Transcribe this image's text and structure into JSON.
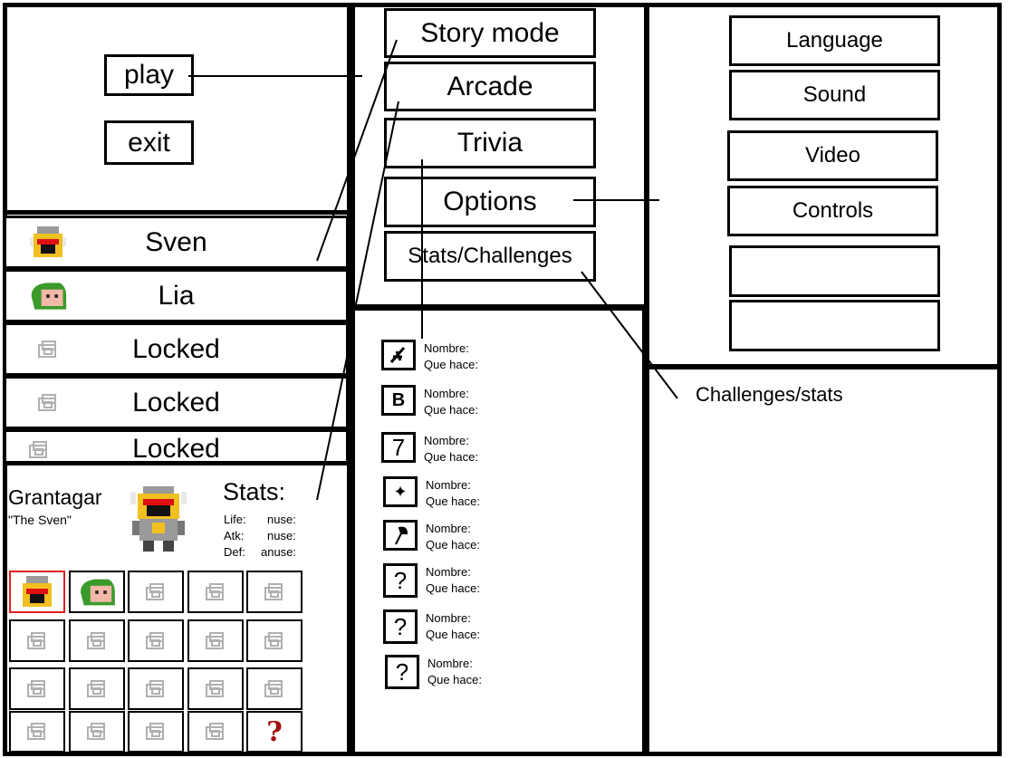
{
  "main_menu": {
    "play_label": "play",
    "exit_label": "exit"
  },
  "mode_menu": {
    "items": [
      {
        "label": "Story mode"
      },
      {
        "label": "Arcade"
      },
      {
        "label": "Trivia"
      },
      {
        "label": "Options"
      },
      {
        "label": "Stats/Challenges"
      }
    ]
  },
  "options_menu": {
    "items": [
      {
        "label": "Language"
      },
      {
        "label": "Sound"
      },
      {
        "label": "Video"
      },
      {
        "label": "Controls"
      },
      {
        "label": ""
      },
      {
        "label": ""
      }
    ]
  },
  "character_list": {
    "items": [
      {
        "name": "Sven",
        "icon": "knight-icon"
      },
      {
        "name": "Lia",
        "icon": "green-hood-icon"
      },
      {
        "name": "Locked",
        "icon": "locked-icon"
      },
      {
        "name": "Locked",
        "icon": "locked-icon"
      },
      {
        "name": "Locked",
        "icon": "locked-icon"
      }
    ]
  },
  "character_detail": {
    "name": "Grantagar",
    "nickname": "\"The Sven\"",
    "stats_title": "Stats:",
    "stats": [
      {
        "label": "Life:",
        "value": "nuse:"
      },
      {
        "label": "Atk:",
        "value": "nuse:"
      },
      {
        "label": "Def:",
        "value": "anuse:"
      }
    ],
    "grid_selected_index": 0,
    "grid": [
      "knight-icon",
      "green-hood-icon",
      "locked-icon",
      "locked-icon",
      "locked-icon",
      "locked-icon",
      "locked-icon",
      "locked-icon",
      "locked-icon",
      "locked-icon",
      "locked-icon",
      "locked-icon",
      "locked-icon",
      "locked-icon",
      "locked-icon",
      "locked-icon",
      "locked-icon",
      "locked-icon",
      "locked-icon",
      "question-icon"
    ]
  },
  "trivia_panel": {
    "items": [
      {
        "icon": "sword-icon",
        "name_label": "Nombre:",
        "desc_label": "Que hace:"
      },
      {
        "icon": "b-glyph-icon",
        "name_label": "Nombre:",
        "desc_label": "Que hace:"
      },
      {
        "icon": "seven-icon",
        "name_label": "Nombre:",
        "desc_label": "Que hace:"
      },
      {
        "icon": "star-icon",
        "name_label": "Nombre:",
        "desc_label": "Que hace:"
      },
      {
        "icon": "axe-icon",
        "name_label": "Nombre:",
        "desc_label": "Que hace:"
      },
      {
        "icon": "question-icon",
        "name_label": "Nombre:",
        "desc_label": "Que hace:"
      },
      {
        "icon": "question-icon",
        "name_label": "Nombre:",
        "desc_label": "Que hace:"
      },
      {
        "icon": "question-icon",
        "name_label": "Nombre:",
        "desc_label": "Que hace:"
      }
    ]
  },
  "challenges_panel": {
    "label": "Challenges/stats"
  },
  "colors": {
    "border": "#000000",
    "selected": "#e02020",
    "knight_gold": "#f0c020",
    "hood_green": "#3a9a2a",
    "lock_gray": "#b0b0b0",
    "question_red": "#a01010"
  }
}
